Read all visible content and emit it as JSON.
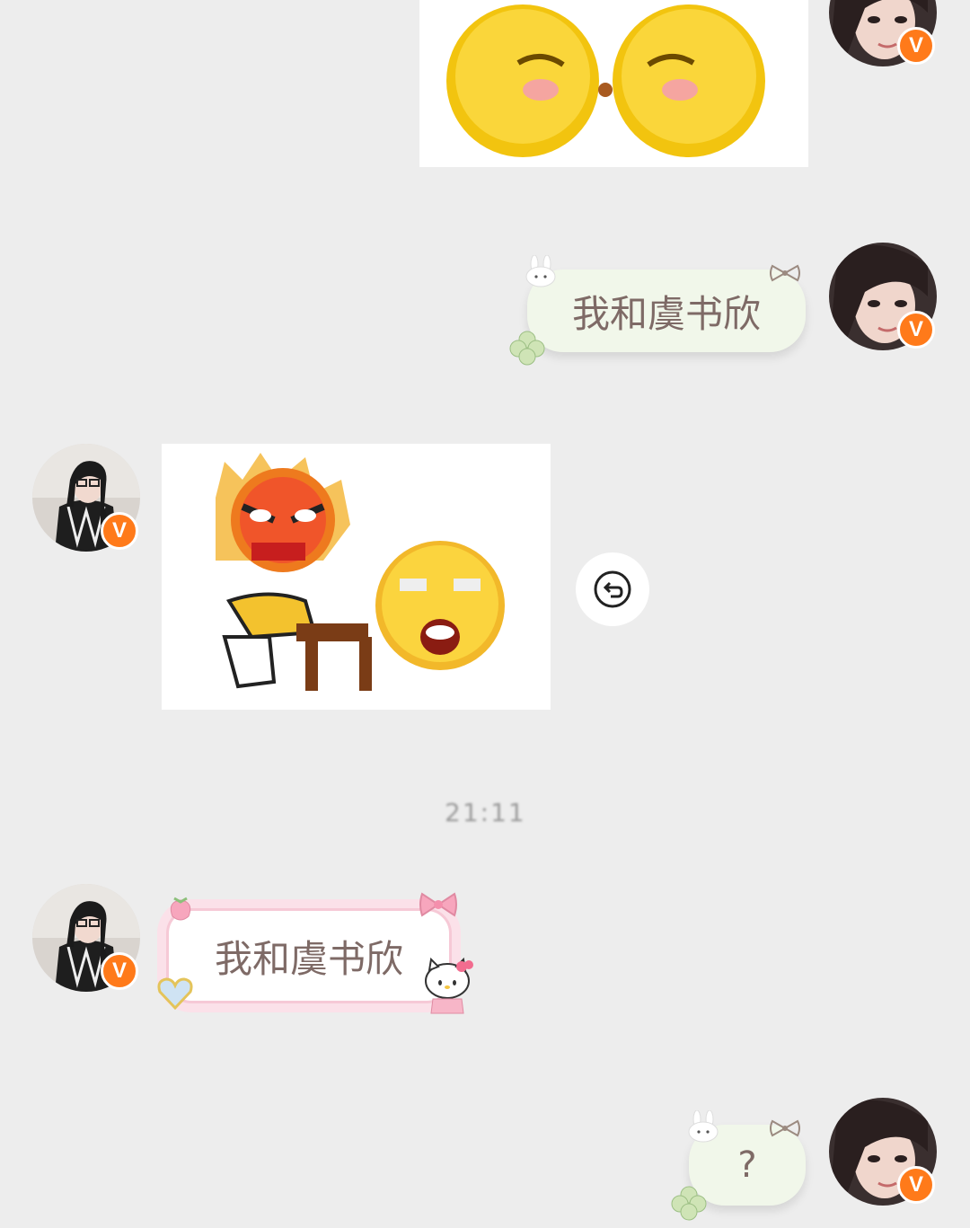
{
  "messages": {
    "m2": {
      "text": "我和虞书欣"
    },
    "m4": {
      "text": "我和虞书欣"
    },
    "m5": {
      "text": "?"
    }
  },
  "timestamp": "21:11",
  "icons": {
    "verified": "V",
    "revoke": "undo-icon"
  },
  "colors": {
    "background": "#ededed",
    "verified_badge": "#ff7a1a",
    "green_bubble": "#f1f7ea",
    "pink_bubble_border": "#f6c9d6"
  }
}
